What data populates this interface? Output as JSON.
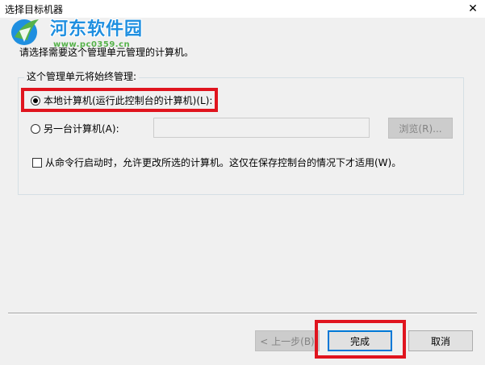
{
  "window": {
    "title": "选择目标机器",
    "close_label": "✕"
  },
  "watermark": {
    "site_name": "河东软件园",
    "url": "www.pc0359.cn"
  },
  "instruction": "请选择需要这个管理单元管理的计算机。",
  "group": {
    "label": "这个管理单元将始终管理:",
    "local_option": {
      "label": "本地计算机(运行此控制台的计算机)(L):",
      "selected": true
    },
    "remote_option": {
      "label": "另一台计算机(A):",
      "selected": false,
      "input_value": ""
    },
    "browse_label": "浏览(R)...",
    "checkbox": {
      "label": "从命令行启动时，允许更改所选的计算机。这仅在保存控制台的情况下才适用(W)。",
      "checked": false
    }
  },
  "footer": {
    "back_label": "< 上一步(B)",
    "finish_label": "完成",
    "cancel_label": "取消"
  },
  "colors": {
    "highlight": "#e0141e",
    "watermark_blue": "#1f8fe0",
    "watermark_green": "#56b24a"
  }
}
